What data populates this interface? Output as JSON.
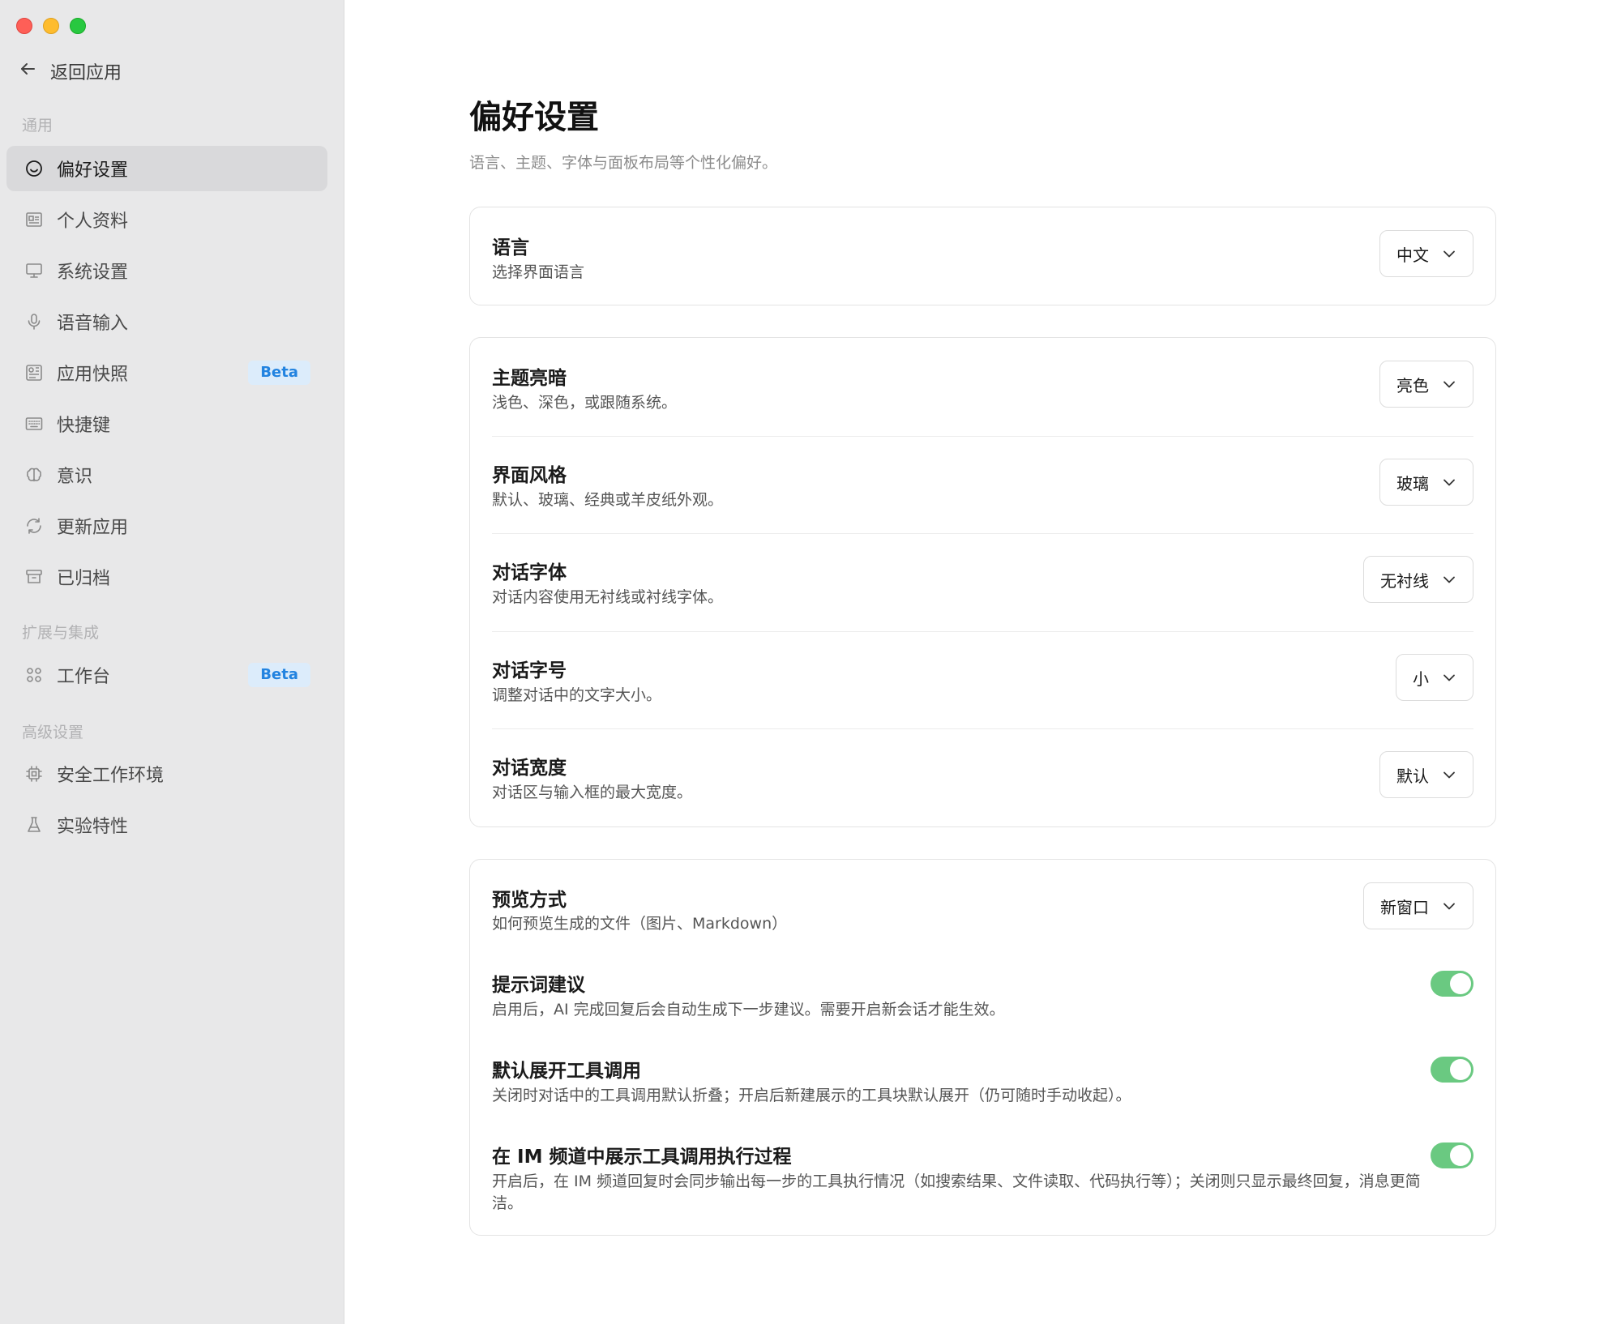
{
  "sidebar": {
    "back_label": "返回应用",
    "sections": [
      {
        "title": "通用"
      },
      {
        "title": "扩展与集成"
      },
      {
        "title": "高级设置"
      }
    ],
    "items": [
      {
        "label": "偏好设置",
        "icon": "smile-icon",
        "active": true
      },
      {
        "label": "个人资料",
        "icon": "profile-card-icon"
      },
      {
        "label": "系统设置",
        "icon": "monitor-icon"
      },
      {
        "label": "语音输入",
        "icon": "microphone-icon"
      },
      {
        "label": "应用快照",
        "icon": "snapshot-icon",
        "badge": "Beta"
      },
      {
        "label": "快捷键",
        "icon": "keyboard-icon"
      },
      {
        "label": "意识",
        "icon": "brain-icon"
      },
      {
        "label": "更新应用",
        "icon": "refresh-icon"
      },
      {
        "label": "已归档",
        "icon": "archive-icon"
      },
      {
        "label": "工作台",
        "icon": "grid-icon",
        "badge": "Beta"
      },
      {
        "label": "安全工作环境",
        "icon": "chip-icon"
      },
      {
        "label": "实验特性",
        "icon": "flask-icon"
      }
    ]
  },
  "main": {
    "title": "偏好设置",
    "subtitle": "语言、主题、字体与面板布局等个性化偏好。",
    "language": {
      "title": "语言",
      "desc": "选择界面语言",
      "value": "中文"
    },
    "appearance": [
      {
        "title": "主题亮暗",
        "desc": "浅色、深色，或跟随系统。",
        "value": "亮色"
      },
      {
        "title": "界面风格",
        "desc": "默认、玻璃、经典或羊皮纸外观。",
        "value": "玻璃"
      },
      {
        "title": "对话字体",
        "desc": "对话内容使用无衬线或衬线字体。",
        "value": "无衬线"
      },
      {
        "title": "对话字号",
        "desc": "调整对话中的文字大小。",
        "value": "小"
      },
      {
        "title": "对话宽度",
        "desc": "对话区与输入框的最大宽度。",
        "value": "默认"
      }
    ],
    "behavior": {
      "preview": {
        "title": "预览方式",
        "desc": "如何预览生成的文件（图片、Markdown）",
        "value": "新窗口"
      },
      "toggles": [
        {
          "title": "提示词建议",
          "desc": "启用后，AI 完成回复后会自动生成下一步建议。需要开启新会话才能生效。",
          "on": true
        },
        {
          "title": "默认展开工具调用",
          "desc": "关闭时对话中的工具调用默认折叠；开启后新建展示的工具块默认展开（仍可随时手动收起）。",
          "on": true
        },
        {
          "title": "在 IM 频道中展示工具调用执行过程",
          "desc": "开启后，在 IM 频道回复时会同步输出每一步的工具执行情况（如搜索结果、文件读取、代码执行等）；关闭则只显示最终回复，消息更简洁。",
          "on": true
        }
      ]
    }
  },
  "colors": {
    "sidebar_bg": "#e8e8e9",
    "toggle_on": "#6ac981",
    "badge_bg": "#dcecfb",
    "badge_text": "#2283e0"
  }
}
